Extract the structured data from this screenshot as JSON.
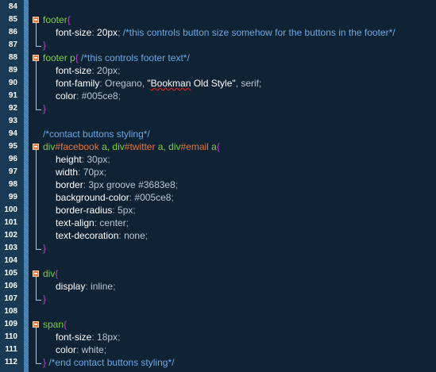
{
  "editor": {
    "language": "css",
    "lines": [
      {
        "num": "84",
        "tokens": []
      },
      {
        "num": "85",
        "fold": "start",
        "tokens": [
          {
            "t": "footer",
            "c": "sel"
          },
          {
            "t": "{",
            "c": "brace"
          }
        ]
      },
      {
        "num": "86",
        "indent": 1,
        "tokens": [
          {
            "t": "font-size",
            "c": "prop"
          },
          {
            "t": ": ",
            "c": "punct"
          },
          {
            "t": "20px",
            "c": "prop"
          },
          {
            "t": "; ",
            "c": "punct"
          },
          {
            "t": "/*this controls button size somehow for the buttons in the footer*/",
            "c": "comment"
          }
        ]
      },
      {
        "num": "87",
        "fold": "end",
        "tokens": [
          {
            "t": "}",
            "c": "brace"
          }
        ]
      },
      {
        "num": "88",
        "fold": "start",
        "tokens": [
          {
            "t": "footer p",
            "c": "sel"
          },
          {
            "t": "{ ",
            "c": "brace"
          },
          {
            "t": "/*this controls footer text*/",
            "c": "comment"
          }
        ]
      },
      {
        "num": "89",
        "indent": 1,
        "tokens": [
          {
            "t": "font-size",
            "c": "prop"
          },
          {
            "t": ": ",
            "c": "punct"
          },
          {
            "t": "20px",
            "c": "val"
          },
          {
            "t": ";",
            "c": "punct"
          }
        ]
      },
      {
        "num": "90",
        "indent": 1,
        "tokens": [
          {
            "t": "font-family",
            "c": "prop"
          },
          {
            "t": ": ",
            "c": "punct"
          },
          {
            "t": "Oregano, ",
            "c": "val"
          },
          {
            "t": "\"",
            "c": "prop"
          },
          {
            "t": "Bookman",
            "c": "prop",
            "spell": true
          },
          {
            "t": " Old Style\"",
            "c": "prop"
          },
          {
            "t": ", serif;",
            "c": "val"
          }
        ]
      },
      {
        "num": "91",
        "indent": 1,
        "tokens": [
          {
            "t": "color",
            "c": "prop"
          },
          {
            "t": ": ",
            "c": "punct"
          },
          {
            "t": "#005ce8",
            "c": "val"
          },
          {
            "t": ";",
            "c": "punct"
          }
        ]
      },
      {
        "num": "92",
        "fold": "end",
        "tokens": [
          {
            "t": "}",
            "c": "brace"
          }
        ]
      },
      {
        "num": "93",
        "tokens": []
      },
      {
        "num": "94",
        "tokens": [
          {
            "t": "/*contact buttons styling*/",
            "c": "comment"
          }
        ]
      },
      {
        "num": "95",
        "fold": "start",
        "tokens": [
          {
            "t": "div",
            "c": "sel"
          },
          {
            "t": "#facebook",
            "c": "id"
          },
          {
            "t": " a, ",
            "c": "sel"
          },
          {
            "t": "div",
            "c": "sel"
          },
          {
            "t": "#twitter",
            "c": "id"
          },
          {
            "t": " a, ",
            "c": "sel"
          },
          {
            "t": "div",
            "c": "sel"
          },
          {
            "t": "#email",
            "c": "id"
          },
          {
            "t": " a",
            "c": "sel"
          },
          {
            "t": "{",
            "c": "brace"
          }
        ]
      },
      {
        "num": "96",
        "indent": 1,
        "tokens": [
          {
            "t": "height",
            "c": "prop"
          },
          {
            "t": ": ",
            "c": "punct"
          },
          {
            "t": "30px",
            "c": "val"
          },
          {
            "t": ";",
            "c": "punct"
          }
        ]
      },
      {
        "num": "97",
        "indent": 1,
        "tokens": [
          {
            "t": "width",
            "c": "prop"
          },
          {
            "t": ": ",
            "c": "punct"
          },
          {
            "t": "70px",
            "c": "val"
          },
          {
            "t": ";",
            "c": "punct"
          }
        ]
      },
      {
        "num": "98",
        "indent": 1,
        "tokens": [
          {
            "t": "border",
            "c": "prop"
          },
          {
            "t": ": ",
            "c": "punct"
          },
          {
            "t": "3px groove #3683e8",
            "c": "val"
          },
          {
            "t": ";",
            "c": "punct"
          }
        ]
      },
      {
        "num": "99",
        "indent": 1,
        "tokens": [
          {
            "t": "background-color",
            "c": "prop"
          },
          {
            "t": ": ",
            "c": "punct"
          },
          {
            "t": "#005ce8",
            "c": "val"
          },
          {
            "t": ";",
            "c": "punct"
          }
        ]
      },
      {
        "num": "100",
        "indent": 1,
        "tokens": [
          {
            "t": "border-radius",
            "c": "prop"
          },
          {
            "t": ": ",
            "c": "punct"
          },
          {
            "t": "5px",
            "c": "val"
          },
          {
            "t": ";",
            "c": "punct"
          }
        ]
      },
      {
        "num": "101",
        "indent": 1,
        "tokens": [
          {
            "t": "text-align",
            "c": "prop"
          },
          {
            "t": ": ",
            "c": "punct"
          },
          {
            "t": "center",
            "c": "val"
          },
          {
            "t": ";",
            "c": "punct"
          }
        ]
      },
      {
        "num": "102",
        "indent": 1,
        "tokens": [
          {
            "t": "text-decoration",
            "c": "prop"
          },
          {
            "t": ": ",
            "c": "punct"
          },
          {
            "t": "none",
            "c": "val"
          },
          {
            "t": ";",
            "c": "punct"
          }
        ]
      },
      {
        "num": "103",
        "fold": "end",
        "tokens": [
          {
            "t": "}",
            "c": "brace"
          }
        ]
      },
      {
        "num": "104",
        "tokens": []
      },
      {
        "num": "105",
        "fold": "start",
        "tokens": [
          {
            "t": "div",
            "c": "sel"
          },
          {
            "t": "{",
            "c": "brace"
          }
        ]
      },
      {
        "num": "106",
        "indent": 1,
        "tokens": [
          {
            "t": "display",
            "c": "prop"
          },
          {
            "t": ": ",
            "c": "punct"
          },
          {
            "t": "inline",
            "c": "val"
          },
          {
            "t": ";",
            "c": "punct"
          }
        ]
      },
      {
        "num": "107",
        "fold": "end",
        "tokens": [
          {
            "t": "}",
            "c": "brace"
          }
        ]
      },
      {
        "num": "108",
        "tokens": []
      },
      {
        "num": "109",
        "fold": "start",
        "tokens": [
          {
            "t": "span",
            "c": "sel"
          },
          {
            "t": "{",
            "c": "brace"
          }
        ]
      },
      {
        "num": "110",
        "indent": 1,
        "tokens": [
          {
            "t": "font-size",
            "c": "prop"
          },
          {
            "t": ": ",
            "c": "punct"
          },
          {
            "t": "18px",
            "c": "val"
          },
          {
            "t": ";",
            "c": "punct"
          }
        ]
      },
      {
        "num": "111",
        "indent": 1,
        "tokens": [
          {
            "t": "color",
            "c": "prop"
          },
          {
            "t": ": ",
            "c": "punct"
          },
          {
            "t": "white",
            "c": "val"
          },
          {
            "t": ";",
            "c": "punct"
          }
        ]
      },
      {
        "num": "112",
        "fold": "end",
        "tokens": [
          {
            "t": "} ",
            "c": "brace"
          },
          {
            "t": "/*end contact buttons styling*/",
            "c": "comment"
          }
        ]
      }
    ]
  },
  "colors": {
    "background": "#0f2335",
    "gutter": "#183a55",
    "selector": "#7fd03a",
    "id_selector": "#e9773a",
    "brace": "#c83ad0",
    "property": "#ffffff",
    "value": "#b9c7d4",
    "comment": "#6ea8e6"
  }
}
